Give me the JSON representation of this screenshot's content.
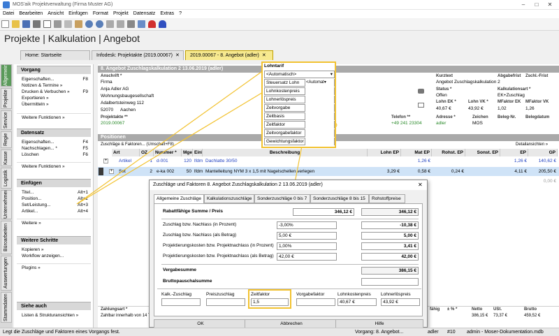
{
  "window": {
    "title": "MOS'aik Projektverwaltung (Firma Muster AG)"
  },
  "menu": [
    "Datei",
    "Bearbeiten",
    "Ansicht",
    "Einfügen",
    "Format",
    "Projekt",
    "Datensatz",
    "Extras",
    "?"
  ],
  "heading": "Projekte | Kalkulation | Angebot",
  "tabs": [
    "Home: Startseite",
    "Infodesk: Projektakte (2019.00067)",
    "2019.00067 - 8. Angebot (adler)"
  ],
  "sideTabs": [
    "Allgemein",
    "Projekte",
    "Service",
    "Regie",
    "Kasse",
    "Logistik",
    "Unternehmer",
    "Büroarbeiten",
    "Auswertungen",
    "Stammdaten"
  ],
  "side": {
    "vorgang": {
      "title": "Vorgang",
      "items": [
        {
          "label": "Eigenschaften...",
          "key": "F8"
        },
        {
          "label": "Notizen & Termine »",
          "key": ""
        },
        {
          "label": "Drucken & Verbuchen »",
          "key": "F9"
        },
        {
          "label": "Exportieren »",
          "key": ""
        },
        {
          "label": "Übermitteln »",
          "key": ""
        }
      ],
      "more": "Weitere Funktionen »"
    },
    "datensatz": {
      "title": "Datensatz",
      "items": [
        {
          "label": "Eigenschaften...",
          "key": "F4"
        },
        {
          "label": "Nachschlagen... *",
          "key": "F5"
        },
        {
          "label": "Löschen",
          "key": "F6"
        }
      ],
      "more": "Weitere Funktionen »"
    },
    "einfuegen": {
      "title": "Einfügen",
      "items": [
        {
          "label": "Titel...",
          "key": "Alt+1"
        },
        {
          "label": "Position...",
          "key": "Alt+2"
        },
        {
          "label": "Set/Leistung...",
          "key": "Alt+3"
        },
        {
          "label": "Artikel...",
          "key": "Alt+4"
        }
      ],
      "more": "Weitere »"
    },
    "schritte": {
      "title": "Weitere Schritte",
      "items": [
        {
          "label": "Kopieren »",
          "key": ""
        },
        {
          "label": "Workflow anzeigen...",
          "key": ""
        }
      ],
      "more": "Plugins »"
    },
    "siehe": {
      "title": "Siehe auch",
      "items": [
        {
          "label": "Listen & Strukturansichten »",
          "key": ""
        }
      ]
    }
  },
  "doc": {
    "title": "8. Angebot Zuschlagskalkulation 2 13.06.2019 (adler)",
    "anschrift_lbl": "Anschrift *",
    "address": [
      "Firma",
      "Anja Adler AG",
      "Wohnungsbaugesellschaft",
      "Adalbertsteinweg 112"
    ],
    "plz": "52070",
    "ort": "Aachen",
    "projektakte_lbl": "Projektakte **",
    "projektakte": "2019.00067",
    "telefon_lbl": "Telefon **",
    "telefon": "+49 241 23304",
    "kurztext_lbl": "Kurztext",
    "kurztext": "Angebot Zuschlagskalkulation 2",
    "abgabefrist_lbl": "Abgabefrist",
    "zschl_lbl": "Zschl.-Frist",
    "status_lbl": "Status *",
    "status": "Offen",
    "kalkart_lbl": "Kalkulationsart *",
    "kalkart": "EK+Zuschlag",
    "lohnek_lbl": "Lohn EK *",
    "lohnek": "40,67 €",
    "lohnvk_lbl": "Lohn VK *",
    "lohnvk": "43,92 €",
    "mfek_lbl": "MFaktor EK",
    "mfek": "1,02",
    "mfvk_lbl": "MFaktor VK",
    "mfvk": "1,26",
    "adresse_lbl": "Adresse *",
    "adresse": "adler",
    "zeichen_lbl": "Zeichen",
    "zeichen": "MOS",
    "belegnr_lbl": "Beleg-Nr.",
    "belegdatum_lbl": "Belegdatum",
    "positionen": "Positionen",
    "pos_sub": "Zuschläge & Faktoren... (Umschalt+F8)",
    "detail": "Detailansichten »",
    "cols": [
      "Art",
      "OZ",
      "Nummer *",
      "Mge",
      "Einh",
      "Beschreibung",
      "Lohn EP",
      "Mat EP",
      "Rohst. EP",
      "Sonst. EP",
      "EP",
      "GP"
    ],
    "rows": [
      [
        "Artikel",
        "1",
        "d-001",
        "120",
        "lfdm",
        "Dachlatte 30/50",
        "",
        "1,26 €",
        "",
        "",
        "1,26 €",
        "140,62 €"
      ],
      [
        "Set",
        "2",
        "e-ka 002",
        "50",
        "lfdm",
        "Mantelleitung NYM 3 x 1,5 mit Nagelschellen verlegen",
        "3,29 €",
        "0,58 €",
        "0,24 €",
        "",
        "4,11 €",
        "205,50 €"
      ]
    ],
    "zero": "0,00 €",
    "foot_cols": [
      "Zahlungsart *",
      "fähig",
      "± % *",
      "Netto",
      "USt.",
      "Brutto"
    ],
    "foot_vals": [
      "Zahlbar innerhalb von 14 Ta...",
      "",
      "",
      "386,15 €",
      "73,37 €",
      "459,52 €"
    ]
  },
  "popup": {
    "title": "Lohntarif",
    "rows": [
      "<Automatisch>",
      "Steuersatz Lohn",
      "Lohnkostenpreis",
      "Lohnerlöspreis",
      "Zeitvorgabe",
      "Zeitbasis",
      "Zeitfaktor",
      "Zeitvorgabefaktor",
      "Gewichtungsfaktor"
    ],
    "steuer_val": "<Automat"
  },
  "dialog": {
    "title": "Zuschläge und Faktoren 8. Angebot Zuschlagskalkulation 2 13.06.2019 (adler)",
    "tabs": [
      "Allgemeine Zuschläge",
      "Kalkulationszuschläge",
      "Sonderzuschläge 0 bis 7",
      "Sonderzuschläge 8 bis 15",
      "Rohstoffpreise"
    ],
    "rabatt_lbl": "Rabattfähige Summe / Preis",
    "rabatt_a": "346,12 €",
    "rabatt_b": "346,12 €",
    "lines": [
      {
        "label": "Zuschlag bzw. Nachlass (in Prozent)",
        "input": "-3,00%",
        "value": "-10,38 €"
      },
      {
        "label": "Zuschlag bzw. Nachlass (als Betrag)",
        "input": "5,00 €",
        "value": "5,00 €"
      },
      {
        "label": "Projektierungskosten bzw. Projektnachlass (in Prozent)",
        "input": "1,00%",
        "value": "3,41 €"
      },
      {
        "label": "Projektierungskosten bzw. Projektnachlass (als Betrag)",
        "input": "42,00 €",
        "value": "42,00 €"
      }
    ],
    "verg_lbl": "Vergabesumme",
    "verg": "386,15 €",
    "brutto_lbl": "Bruttopauschalsumme",
    "bottom_lbls": [
      "Kalk.-Zuschlag",
      "Preiszuschlag",
      "Zeitfaktor",
      "Vorgabefaktor",
      "Lohnkostenpreis",
      "Lohnerlöspreis"
    ],
    "bottom_vals": [
      "",
      "",
      "1,5",
      "",
      "40,67 €",
      "43,92 €"
    ],
    "ok": "OK",
    "abbrechen": "Abbrechen",
    "hilfe": "Hilfe"
  },
  "status": {
    "msg": "Legt die Zuschläge und Faktoren eines Vorgangs fest.",
    "vorgang": "Vorgang: 8. Angebot...",
    "user": "adler",
    "num": "#10",
    "db": "admin - Moser-Dokumentation.mdb"
  },
  "colors": {
    "accent": "#f2c230",
    "green": "#5a9a5a"
  }
}
